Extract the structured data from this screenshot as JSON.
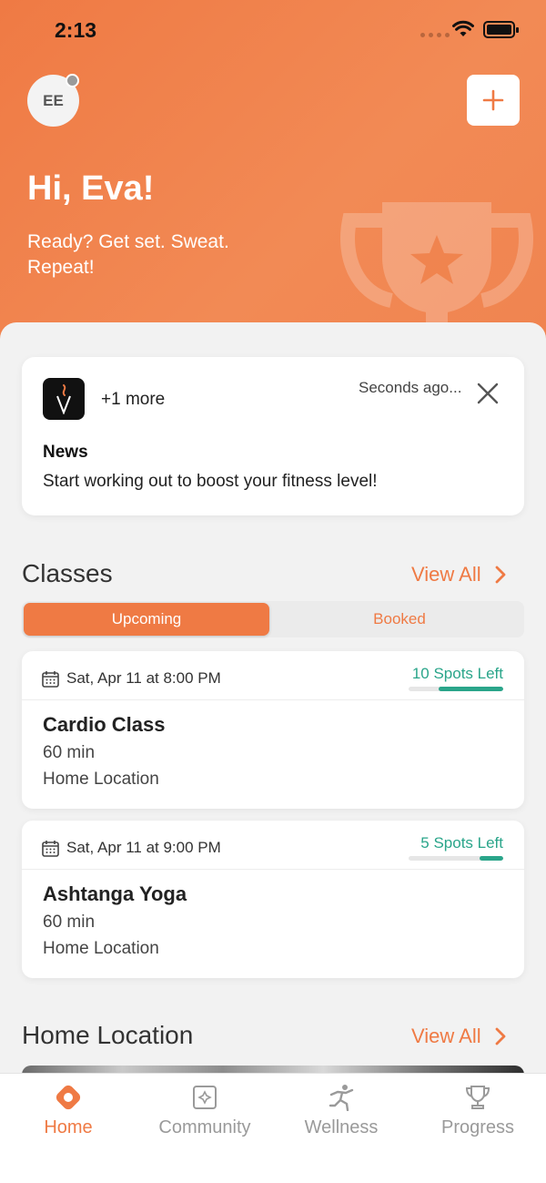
{
  "status_bar": {
    "time": "2:13"
  },
  "header": {
    "avatar_initials": "EE",
    "greeting": "Hi, Eva!",
    "tagline": "Ready? Get set. Sweat. Repeat!"
  },
  "news": {
    "more": "+1 more",
    "time": "Seconds ago...",
    "title": "News",
    "text": "Start working out to boost your fitness level!"
  },
  "classes": {
    "title": "Classes",
    "view_all": "View All",
    "tabs": [
      {
        "label": "Upcoming",
        "active": true
      },
      {
        "label": "Booked",
        "active": false
      }
    ],
    "items": [
      {
        "date": "Sat, Apr 11 at 8:00 PM",
        "spots": "10 Spots Left",
        "spots_fraction": 0.68,
        "name": "Cardio Class",
        "duration": "60 min",
        "location": "Home Location"
      },
      {
        "date": "Sat, Apr 11 at 9:00 PM",
        "spots": "5 Spots Left",
        "spots_fraction": 0.25,
        "name": "Ashtanga Yoga",
        "duration": "60 min",
        "location": "Home Location"
      }
    ]
  },
  "home_location": {
    "title": "Home Location",
    "view_all": "View All"
  },
  "tabbar": [
    {
      "label": "Home",
      "icon": "home-icon",
      "active": true
    },
    {
      "label": "Community",
      "icon": "community-icon",
      "active": false
    },
    {
      "label": "Wellness",
      "icon": "wellness-icon",
      "active": false
    },
    {
      "label": "Progress",
      "icon": "trophy-icon",
      "active": false
    }
  ],
  "colors": {
    "accent": "#ef7a44",
    "spots": "#2aa58a"
  }
}
